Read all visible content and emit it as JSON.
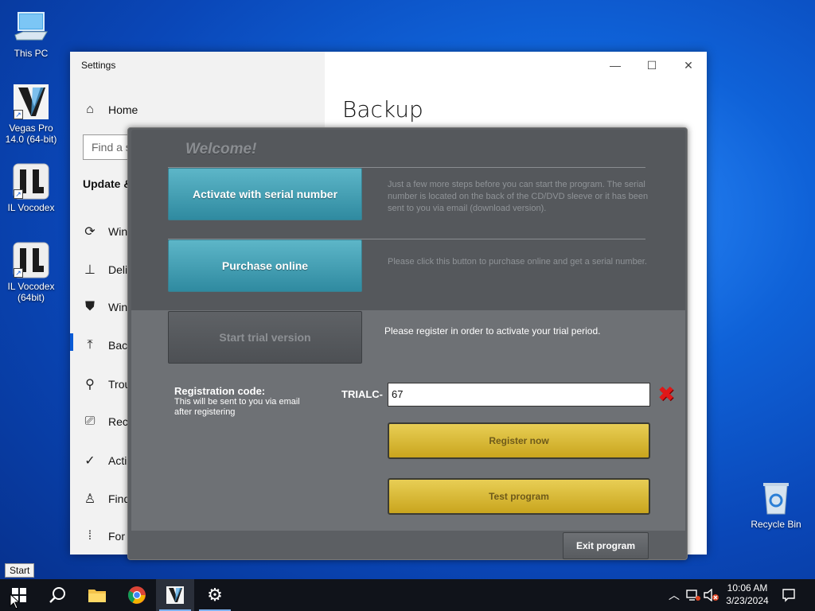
{
  "desktop": {
    "icons": [
      {
        "label": "This PC",
        "icon": "computer-icon"
      },
      {
        "label": "Vegas Pro 14.0 (64-bit)",
        "icon": "vegas-pro-icon"
      },
      {
        "label": "IL Vocodex",
        "icon": "il-vocodex-icon"
      },
      {
        "label": "IL Vocodex (64bit)",
        "icon": "il-vocodex-icon"
      },
      {
        "label": "Recycle Bin",
        "icon": "recycle-bin-icon"
      }
    ]
  },
  "settings": {
    "title": "Settings",
    "page_title": "Backup",
    "home": "Home",
    "search_placeholder": "Find a s",
    "section": "Update &",
    "items": [
      {
        "label": "Win",
        "icon": "refresh-icon"
      },
      {
        "label": "Deli",
        "icon": "delivery-icon"
      },
      {
        "label": "Win",
        "icon": "shield-icon"
      },
      {
        "label": "Back",
        "icon": "upload-icon"
      },
      {
        "label": "Trou",
        "icon": "wrench-icon"
      },
      {
        "label": "Reco",
        "icon": "recovery-icon"
      },
      {
        "label": "Acti",
        "icon": "check-circle-icon"
      },
      {
        "label": "Find",
        "icon": "person-icon"
      },
      {
        "label": "For",
        "icon": "developer-icon"
      }
    ]
  },
  "dialog": {
    "welcome": "Welcome!",
    "activate_label": "Activate with serial number",
    "activate_desc": "Just a few more steps before you can start the program. The serial number is located on the back of the CD/DVD sleeve or it has been sent to you via email (download version).",
    "purchase_label": "Purchase online",
    "purchase_desc": "Please click this button to purchase online and get a serial number.",
    "trial_label": "Start trial version",
    "trial_note": "Please register in order to activate your trial period.",
    "reg_title": "Registration code:",
    "reg_sub": "This will be sent to you via email after registering",
    "prefix": "TRIALC-",
    "code_value": "67",
    "register_label": "Register now",
    "test_label": "Test program",
    "exit_label": "Exit program"
  },
  "taskbar": {
    "start_tooltip": "Start",
    "time": "10:06 AM",
    "date": "3/23/2024",
    "accent": "#0a5bd6"
  }
}
